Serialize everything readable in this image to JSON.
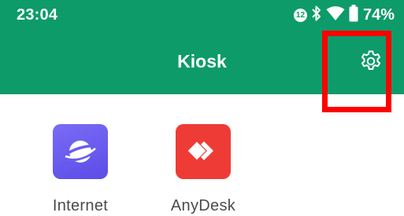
{
  "status_bar": {
    "time": "23:04",
    "notification_count": "12",
    "battery": "74%",
    "icons": [
      "notification-badge-icon",
      "bluetooth-icon",
      "wifi-icon",
      "battery-icon"
    ]
  },
  "app_bar": {
    "title": "Kiosk",
    "settings_icon": "gear-icon"
  },
  "colors": {
    "primary": "#0d9b6a",
    "highlight": "#ff0000",
    "internet_icon_bg": "#6b5cf0",
    "anydesk_icon_bg": "#ef3b35"
  },
  "apps": [
    {
      "label": "Internet",
      "icon": "samsung-internet-icon"
    },
    {
      "label": "AnyDesk",
      "icon": "anydesk-icon"
    }
  ]
}
